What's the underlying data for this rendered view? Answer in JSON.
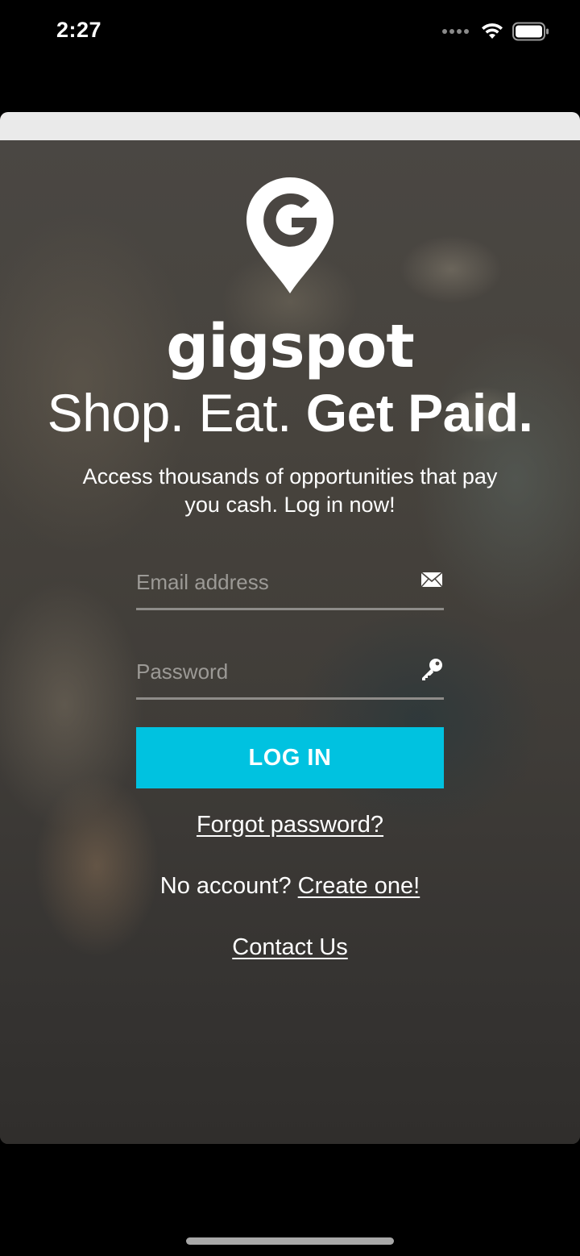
{
  "status_bar": {
    "time": "2:27"
  },
  "brand": {
    "name": "gigspot",
    "logo_letter": "G",
    "accent_color": "#00c2e0"
  },
  "headline": {
    "regular": "Shop. Eat. ",
    "bold": "Get Paid."
  },
  "subtitle": "Access thousands of opportunities that pay you cash. Log in now!",
  "form": {
    "email_placeholder": "Email address",
    "email_value": "",
    "email_icon": "envelope-icon",
    "password_placeholder": "Password",
    "password_value": "",
    "password_icon": "key-icon",
    "login_label": "LOG IN"
  },
  "links": {
    "forgot_password": "Forgot password?",
    "no_account_prefix": "No account? ",
    "create_account": "Create one!",
    "contact_us": "Contact Us"
  }
}
